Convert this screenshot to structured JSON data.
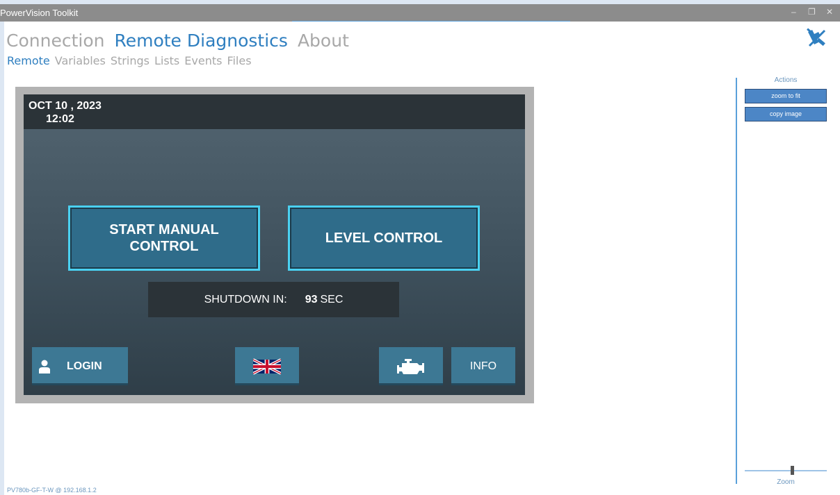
{
  "window": {
    "title": "PowerVision Toolkit",
    "minimize": "–",
    "restore": "❐",
    "close": "✕"
  },
  "nav": {
    "main": [
      "Connection",
      "Remote Diagnostics",
      "About"
    ],
    "sub": [
      "Remote",
      "Variables",
      "Strings",
      "Lists",
      "Events",
      "Files"
    ]
  },
  "device": {
    "date": "OCT 10 , 2023",
    "time": "12:02",
    "start_manual": "START MANUAL CONTROL",
    "level_control": "LEVEL CONTROL",
    "shutdown_label": "SHUTDOWN IN:",
    "shutdown_value": "93",
    "shutdown_unit": "SEC",
    "login": "LOGIN",
    "info": "INFO"
  },
  "actions": {
    "title": "Actions",
    "zoom_to_fit": "zoom to fit",
    "copy_image": "copy image",
    "zoom_label": "Zoom"
  },
  "status": "PV780b-GF-T-W @ 192.168.1.2",
  "colors": {
    "accent": "#2f7fc0",
    "button_border": "#4ad1f1",
    "titlebar": "#8c8c8c"
  }
}
